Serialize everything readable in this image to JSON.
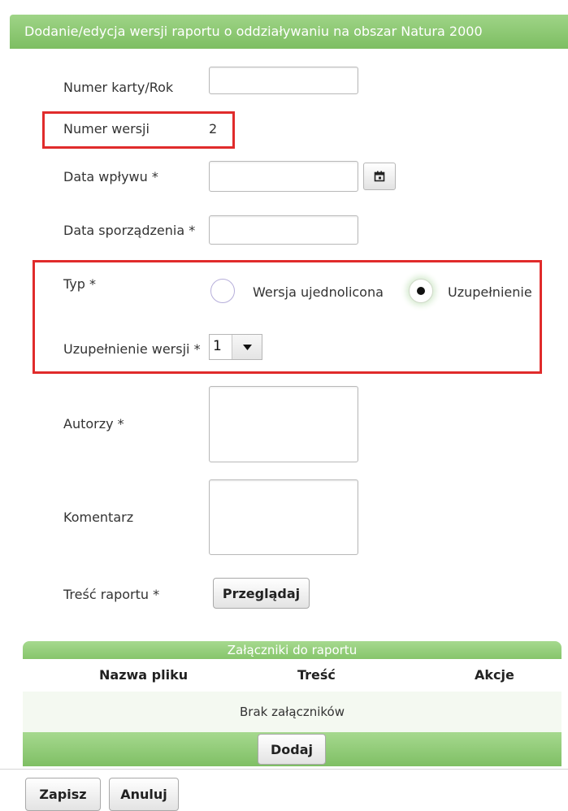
{
  "window": {
    "title": "Dodanie/edycja wersji raportu o oddziaływaniu na obszar Natura 2000"
  },
  "form": {
    "card_number_label": "Numer karty/Rok",
    "card_number_value": "",
    "version_label": "Numer wersji",
    "version_value": "2",
    "receipt_date_label": "Data wpływu *",
    "receipt_date_value": "",
    "prepared_date_label": "Data sporządzenia *",
    "prepared_date_value": "",
    "type_label": "Typ *",
    "type_options": [
      {
        "label": "Wersja ujednolicona",
        "selected": false
      },
      {
        "label": "Uzupełnienie",
        "selected": true
      }
    ],
    "supplement_label": "Uzupełnienie wersji *",
    "supplement_value": "1",
    "authors_label": "Autorzy *",
    "authors_value": "",
    "comment_label": "Komentarz",
    "comment_value": "",
    "content_label": "Treść raportu *",
    "browse_button": "Przeglądaj"
  },
  "attachments": {
    "header": "Załączniki do raportu",
    "columns": [
      "Nazwa pliku",
      "Treść",
      "Akcje"
    ],
    "empty_text": "Brak załączników",
    "add_button": "Dodaj"
  },
  "footer": {
    "save_button": "Zapisz",
    "cancel_button": "Anuluj"
  },
  "icons": {
    "calendar": "calendar-icon",
    "dropdown": "chevron-down-icon"
  },
  "colors": {
    "accent_green": "#86c56b",
    "highlight_red": "#e02b2b"
  }
}
